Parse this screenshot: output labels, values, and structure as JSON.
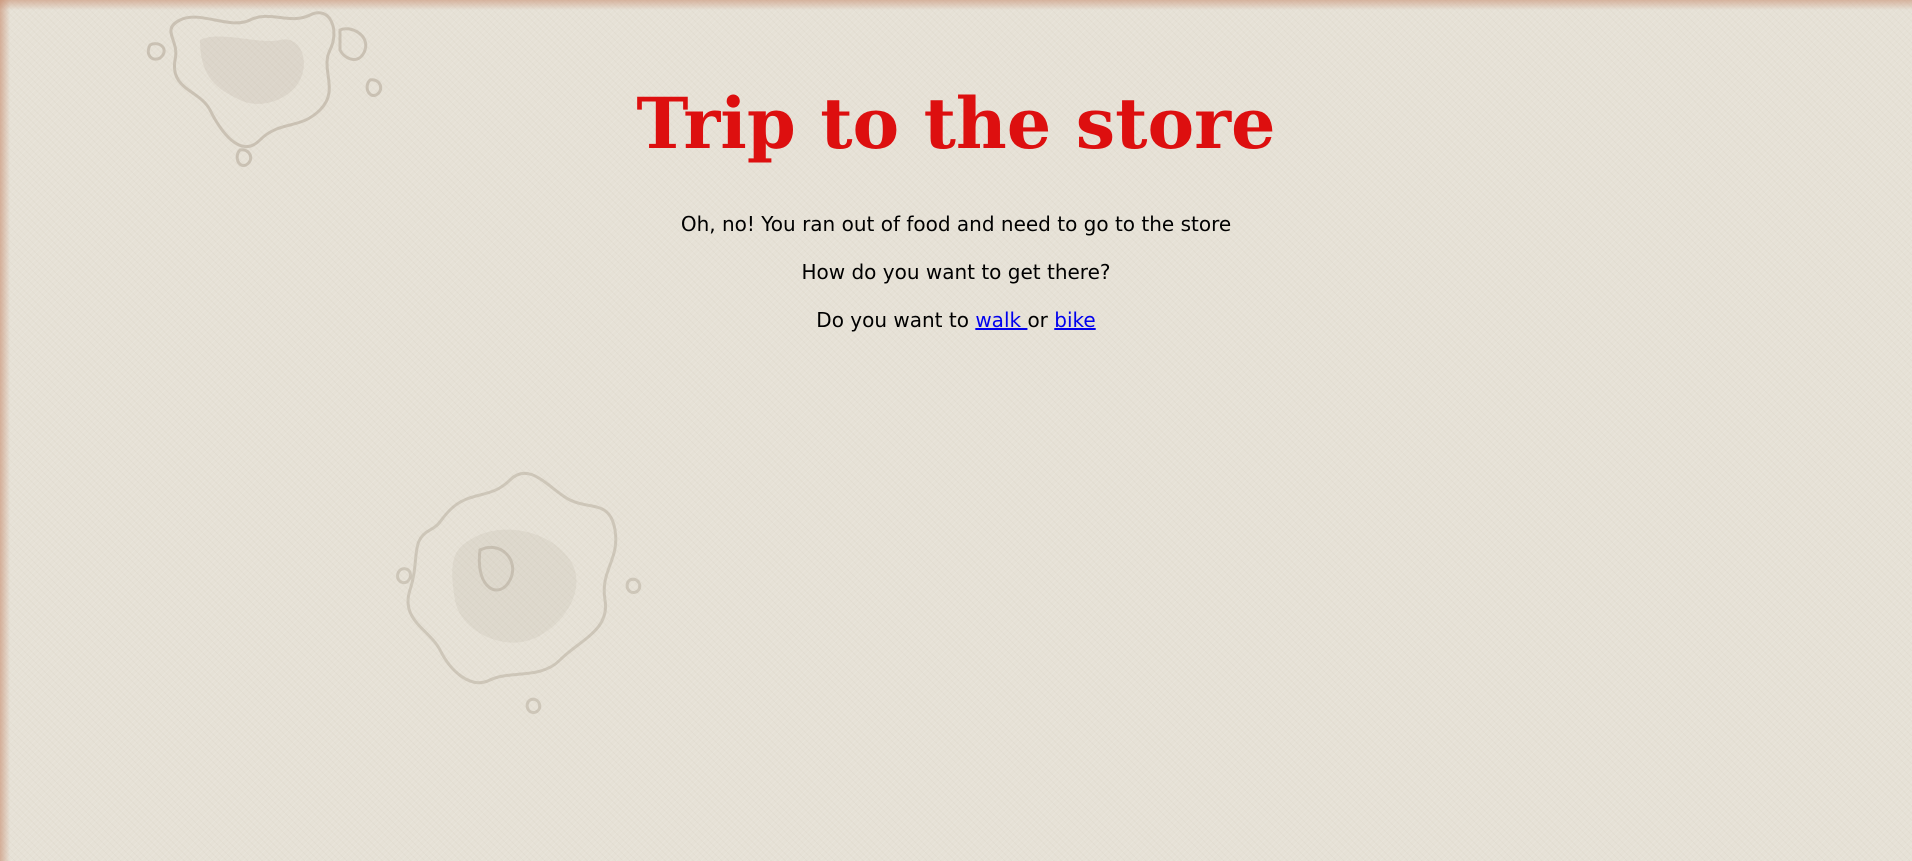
{
  "page": {
    "title": "Trip to the store",
    "intro": "Oh, no! You ran out of food and need to go to the store",
    "question": "How do you want to get there?",
    "choice_prefix": "Do you want to ",
    "choice_walk": "walk ",
    "choice_separator": "or ",
    "choice_bike": "bike"
  },
  "colors": {
    "title": "#dd0f0f",
    "text": "#000000",
    "link": "#0000ee",
    "background": "#e6e1d6"
  }
}
